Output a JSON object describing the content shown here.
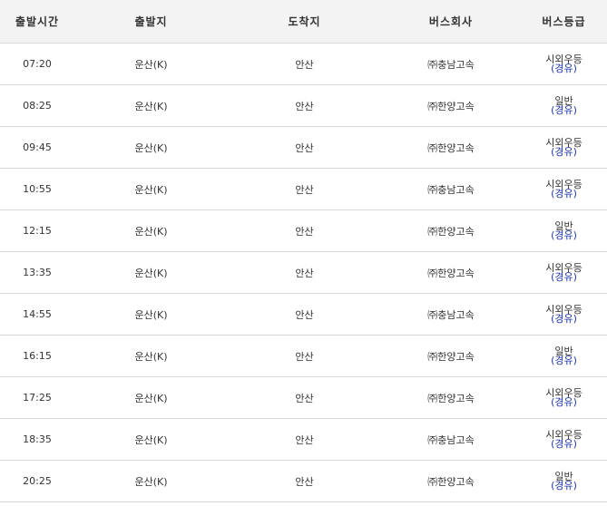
{
  "headers": [
    "출발시간",
    "출발지",
    "도착지",
    "버스회사",
    "버스등급"
  ],
  "rows": [
    {
      "time": "07:20",
      "from": "운산(K)",
      "to": "안산",
      "company": "㈜충남고속",
      "grade": "시외우등",
      "via": "(경유)"
    },
    {
      "time": "08:25",
      "from": "운산(K)",
      "to": "안산",
      "company": "㈜한양고속",
      "grade": "일반",
      "via": "(경유)"
    },
    {
      "time": "09:45",
      "from": "운산(K)",
      "to": "안산",
      "company": "㈜한양고속",
      "grade": "시외우등",
      "via": "(경유)"
    },
    {
      "time": "10:55",
      "from": "운산(K)",
      "to": "안산",
      "company": "㈜충남고속",
      "grade": "시외우등",
      "via": "(경유)"
    },
    {
      "time": "12:15",
      "from": "운산(K)",
      "to": "안산",
      "company": "㈜한양고속",
      "grade": "일반",
      "via": "(경유)"
    },
    {
      "time": "13:35",
      "from": "운산(K)",
      "to": "안산",
      "company": "㈜한양고속",
      "grade": "시외우등",
      "via": "(경유)"
    },
    {
      "time": "14:55",
      "from": "운산(K)",
      "to": "안산",
      "company": "㈜충남고속",
      "grade": "시외우등",
      "via": "(경유)"
    },
    {
      "time": "16:15",
      "from": "운산(K)",
      "to": "안산",
      "company": "㈜한양고속",
      "grade": "일반",
      "via": "(경유)"
    },
    {
      "time": "17:25",
      "from": "운산(K)",
      "to": "안산",
      "company": "㈜한양고속",
      "grade": "시외우등",
      "via": "(경유)"
    },
    {
      "time": "18:35",
      "from": "운산(K)",
      "to": "안산",
      "company": "㈜충남고속",
      "grade": "시외우등",
      "via": "(경유)"
    },
    {
      "time": "20:25",
      "from": "운산(K)",
      "to": "안산",
      "company": "㈜한양고속",
      "grade": "일반",
      "via": "(경유)"
    }
  ]
}
